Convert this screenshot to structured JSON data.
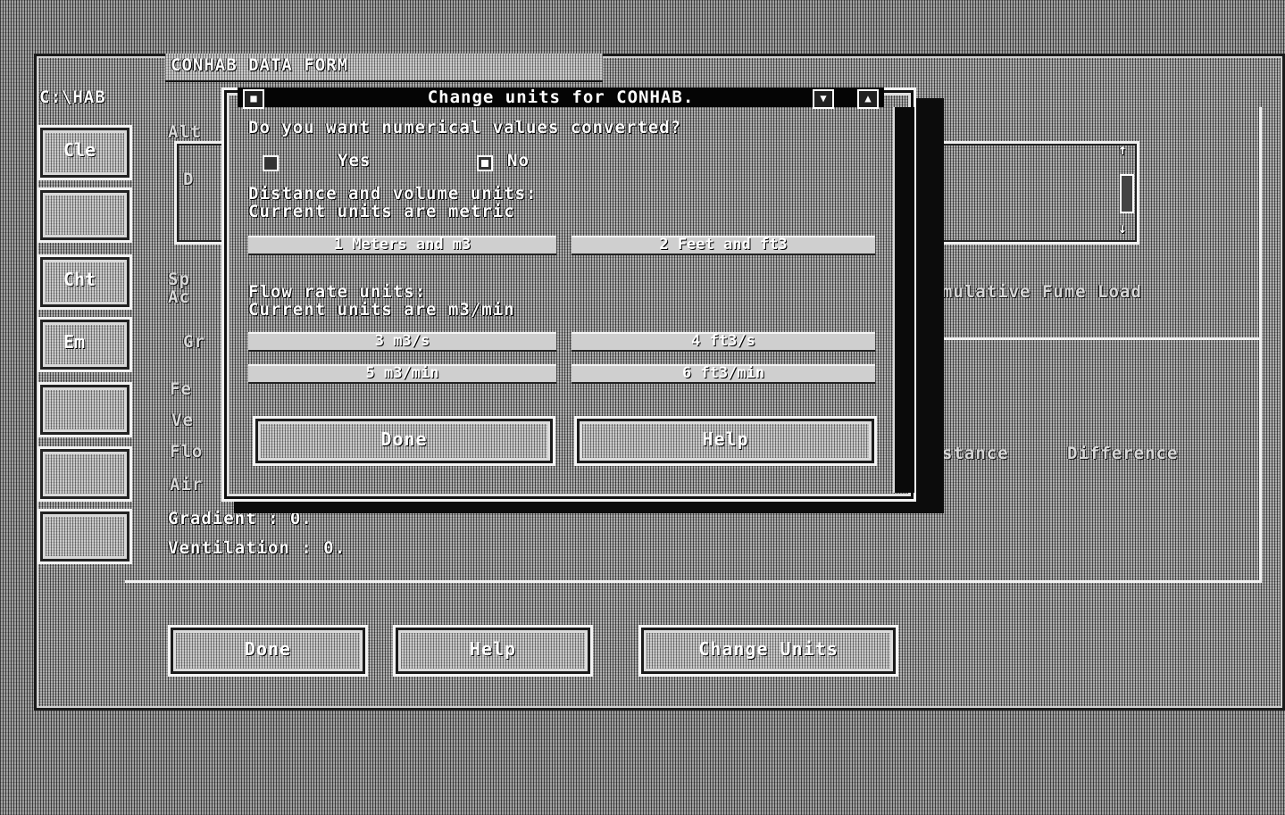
{
  "background_window": {
    "title": "CONHAB DATA FORM",
    "left_fragment": "C:\\HAB",
    "side_buttons": [
      {
        "label": "Cle"
      },
      {
        "label": ""
      },
      {
        "label": "Cht"
      },
      {
        "label": "Em"
      },
      {
        "label": ""
      },
      {
        "label": ""
      },
      {
        "label": ""
      }
    ],
    "row_fragments": {
      "r1": "Alt",
      "r2": "D",
      "r3": "Sp",
      "r4": "Ac",
      "r5": "Gr",
      "r6": "Fe",
      "r7": "Ve",
      "r8": "Flo",
      "r9": "Air",
      "r10": "Gradient : 0.",
      "r11": "Ventilation : 0."
    },
    "right_fragments": {
      "a": "Cumulative Fume Load",
      "b": "Distance",
      "c": "Difference"
    },
    "scroll_up_icon": "arrow-up",
    "scroll_down_icon": "arrow-down",
    "bottom_buttons": {
      "done": "Done",
      "help": "Help",
      "change_units": "Change Units"
    }
  },
  "dialog": {
    "title": "Change units for CONHAB.",
    "question": "Do you want numerical values converted?",
    "yes_label": "Yes",
    "no_label": "No",
    "selected": "No",
    "distance_heading": "Distance and volume units:",
    "distance_current": "Current units are metric",
    "distance_options": {
      "metric": "1 Meters and m3",
      "imperial": "2 Feet and ft3"
    },
    "flow_heading": "Flow rate units:",
    "flow_current": "Current units are m3/min",
    "flow_options": {
      "m3s": "3 m3/s",
      "cfm": "4 ft3/s",
      "m3min": "5 m3/min",
      "ft3min": "6 ft3/min"
    },
    "done_label": "Done",
    "help_label": "Help",
    "ctrl_icons": {
      "close": "close-box",
      "minimize": "down-arrow",
      "maximize": "up-arrow"
    }
  }
}
